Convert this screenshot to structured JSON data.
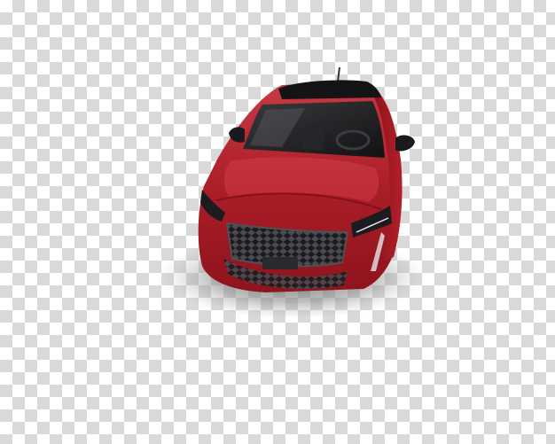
{
  "image": {
    "subject": "car-render",
    "background": "transparency-checkerboard"
  },
  "colors": {
    "checker_light": "#ffffff",
    "checker_dark": "#d9d9d9",
    "body_red": "#b3202a",
    "body_red_dark": "#7a0f16",
    "body_highlight": "#d9434b",
    "glass": "#1a1a1c",
    "grille": "#2a2a2e",
    "shadow": "#8a8a8a"
  }
}
